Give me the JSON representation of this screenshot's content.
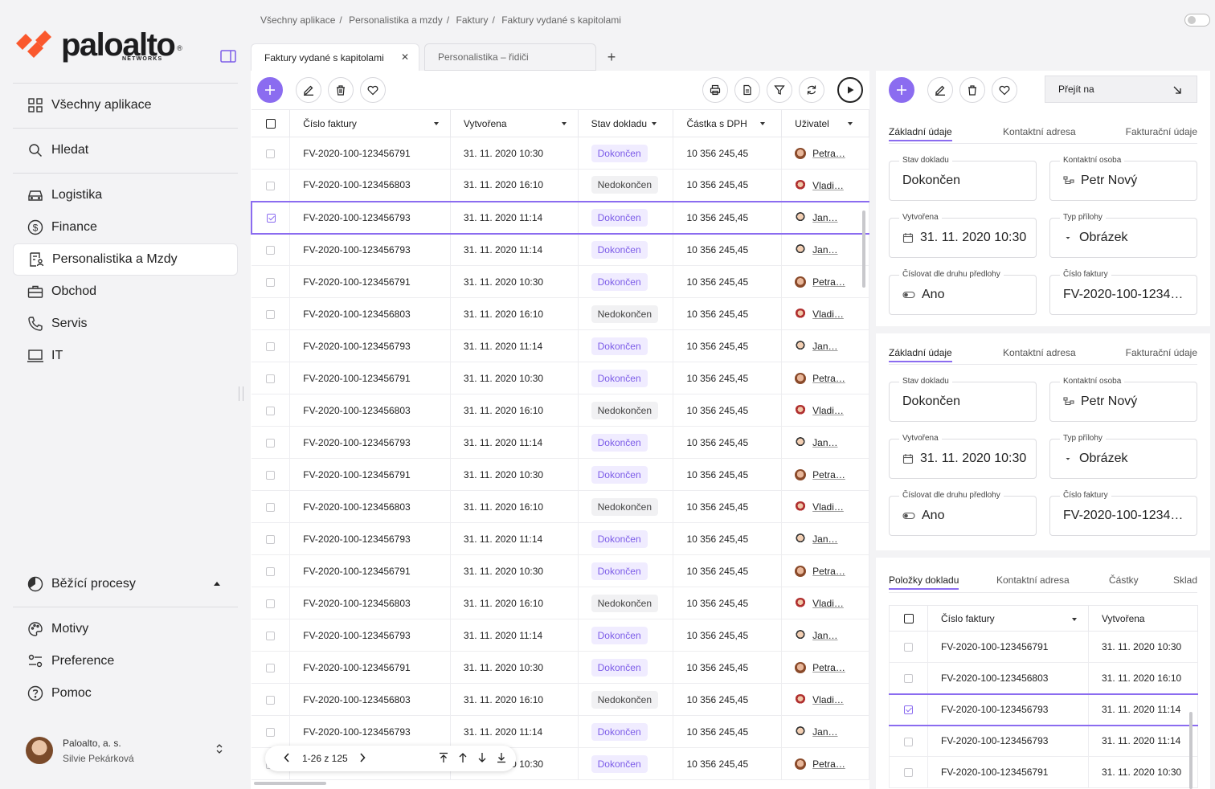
{
  "brand": {
    "name": "paloalto",
    "sub": "NETWORKS",
    "reg": "®"
  },
  "sidebar": {
    "items": [
      {
        "label": "Všechny aplikace",
        "icon": "grid-icon"
      },
      {
        "label": "Hledat",
        "icon": "search-icon"
      },
      {
        "label": "Logistika",
        "icon": "car-icon"
      },
      {
        "label": "Finance",
        "icon": "dollar-icon"
      },
      {
        "label": "Personalistika a Mzdy",
        "icon": "document-person-icon",
        "active": true
      },
      {
        "label": "Obchod",
        "icon": "briefcase-icon"
      },
      {
        "label": "Servis",
        "icon": "phone-icon"
      },
      {
        "label": "IT",
        "icon": "laptop-icon"
      }
    ],
    "bottom_items": [
      {
        "label": "Běžící procesy",
        "icon": "progress-icon"
      },
      {
        "label": "Motivy",
        "icon": "palette-icon"
      },
      {
        "label": "Preference",
        "icon": "sliders-icon"
      },
      {
        "label": "Pomoc",
        "icon": "help-icon"
      }
    ],
    "user": {
      "company": "Paloalto, a. s.",
      "name": "Silvie Pekárková"
    }
  },
  "breadcrumb": [
    "Všechny aplikace",
    "/",
    "Personalistika a mzdy",
    "/",
    "Faktury",
    "/",
    "Faktury vydané s kapitolami"
  ],
  "tabs": [
    {
      "label": "Faktury vydané s kapitolami",
      "active": true
    },
    {
      "label": "Personalistika – řidiči",
      "active": false
    }
  ],
  "grid": {
    "columns": [
      "Číslo faktury",
      "Vytvořena",
      "Stav dokladu",
      "Částka s DPH",
      "Uživatel"
    ],
    "rows": [
      {
        "id": "FV-2020-100-123456791",
        "date": "31. 11. 2020 10:30",
        "status": "Dokončen",
        "amount": "10 356 245,45",
        "user": "Petra…",
        "av": "a"
      },
      {
        "id": "FV-2020-100-123456803",
        "date": "31. 11. 2020 16:10",
        "status": "Nedokončen",
        "amount": "10 356 245,45",
        "user": "Vladi…",
        "av": "b"
      },
      {
        "id": "FV-2020-100-123456793",
        "date": "31. 11. 2020 11:14",
        "status": "Dokončen",
        "amount": "10 356 245,45",
        "user": "Jan…",
        "av": "c",
        "selected": true
      },
      {
        "id": "FV-2020-100-123456793",
        "date": "31. 11. 2020 11:14",
        "status": "Dokončen",
        "amount": "10 356 245,45",
        "user": "Jan…",
        "av": "c"
      },
      {
        "id": "FV-2020-100-123456791",
        "date": "31. 11. 2020 10:30",
        "status": "Dokončen",
        "amount": "10 356 245,45",
        "user": "Petra…",
        "av": "a"
      },
      {
        "id": "FV-2020-100-123456803",
        "date": "31. 11. 2020 16:10",
        "status": "Nedokončen",
        "amount": "10 356 245,45",
        "user": "Vladi…",
        "av": "b"
      },
      {
        "id": "FV-2020-100-123456793",
        "date": "31. 11. 2020 11:14",
        "status": "Dokončen",
        "amount": "10 356 245,45",
        "user": "Jan…",
        "av": "c"
      },
      {
        "id": "FV-2020-100-123456791",
        "date": "31. 11. 2020 10:30",
        "status": "Dokončen",
        "amount": "10 356 245,45",
        "user": "Petra…",
        "av": "a"
      },
      {
        "id": "FV-2020-100-123456803",
        "date": "31. 11. 2020 16:10",
        "status": "Nedokončen",
        "amount": "10 356 245,45",
        "user": "Vladi…",
        "av": "b"
      },
      {
        "id": "FV-2020-100-123456793",
        "date": "31. 11. 2020 11:14",
        "status": "Dokončen",
        "amount": "10 356 245,45",
        "user": "Jan…",
        "av": "c"
      },
      {
        "id": "FV-2020-100-123456791",
        "date": "31. 11. 2020 10:30",
        "status": "Dokončen",
        "amount": "10 356 245,45",
        "user": "Petra…",
        "av": "a"
      },
      {
        "id": "FV-2020-100-123456803",
        "date": "31. 11. 2020 16:10",
        "status": "Nedokončen",
        "amount": "10 356 245,45",
        "user": "Vladi…",
        "av": "b"
      },
      {
        "id": "FV-2020-100-123456793",
        "date": "31. 11. 2020 11:14",
        "status": "Dokončen",
        "amount": "10 356 245,45",
        "user": "Jan…",
        "av": "c"
      },
      {
        "id": "FV-2020-100-123456791",
        "date": "31. 11. 2020 10:30",
        "status": "Dokončen",
        "amount": "10 356 245,45",
        "user": "Petra…",
        "av": "a"
      },
      {
        "id": "FV-2020-100-123456803",
        "date": "31. 11. 2020 16:10",
        "status": "Nedokončen",
        "amount": "10 356 245,45",
        "user": "Vladi…",
        "av": "b"
      },
      {
        "id": "FV-2020-100-123456793",
        "date": "31. 11. 2020 11:14",
        "status": "Dokončen",
        "amount": "10 356 245,45",
        "user": "Jan…",
        "av": "c"
      },
      {
        "id": "FV-2020-100-123456791",
        "date": "31. 11. 2020 10:30",
        "status": "Dokončen",
        "amount": "10 356 245,45",
        "user": "Petra…",
        "av": "a"
      },
      {
        "id": "FV-2020-100-123456803",
        "date": "31. 11. 2020 16:10",
        "status": "Nedokončen",
        "amount": "10 356 245,45",
        "user": "Vladi…",
        "av": "b"
      },
      {
        "id": "FV-2020-100-123456793",
        "date": "31. 11. 2020 11:14",
        "status": "Dokončen",
        "amount": "10 356 245,45",
        "user": "Jan…",
        "av": "c"
      },
      {
        "id": "FV-2020-100-123456791",
        "date": "31. 11. 2020 10:30",
        "status": "Dokončen",
        "amount": "10 356 245,45",
        "user": "Petra…",
        "av": "a"
      }
    ]
  },
  "pager": {
    "range": "1-26 z 125"
  },
  "right": {
    "goto_label": "Přejít na",
    "tabs": [
      "Základní údaje",
      "Kontaktní adresa",
      "Fakturační údaje"
    ],
    "fields": [
      {
        "label": "Stav dokladu",
        "value": "Dokončen"
      },
      {
        "label": "Kontaktní osoba",
        "value": "Petr Nový",
        "icon": "hierarchy-icon"
      },
      {
        "label": "Vytvořena",
        "value": "31. 11. 2020 10:30",
        "icon": "calendar-icon"
      },
      {
        "label": "Typ přílohy",
        "value": "Obrázek",
        "icon": "chevron-down-icon"
      },
      {
        "label": "Číslovat dle druhu předlohy",
        "value": "Ano",
        "icon": "toggle-icon"
      },
      {
        "label": "Číslo faktury",
        "value": "FV-2020-100-1234…"
      }
    ],
    "items_tabs": [
      "Položky dokladu",
      "Kontaktní adresa",
      "Částky",
      "Sklad"
    ],
    "items_columns": [
      "Číslo faktury",
      "Vytvořena"
    ],
    "items_rows": [
      {
        "id": "FV-2020-100-123456791",
        "date": "31. 11. 2020 10:30"
      },
      {
        "id": "FV-2020-100-123456803",
        "date": "31. 11. 2020 16:10"
      },
      {
        "id": "FV-2020-100-123456793",
        "date": "31. 11. 2020 11:14",
        "selected": true
      },
      {
        "id": "FV-2020-100-123456793",
        "date": "31. 11. 2020 11:14"
      },
      {
        "id": "FV-2020-100-123456791",
        "date": "31. 11. 2020 10:30"
      }
    ]
  },
  "colors": {
    "accent": "#8b6cf0",
    "brand_red": "#fa582d"
  }
}
